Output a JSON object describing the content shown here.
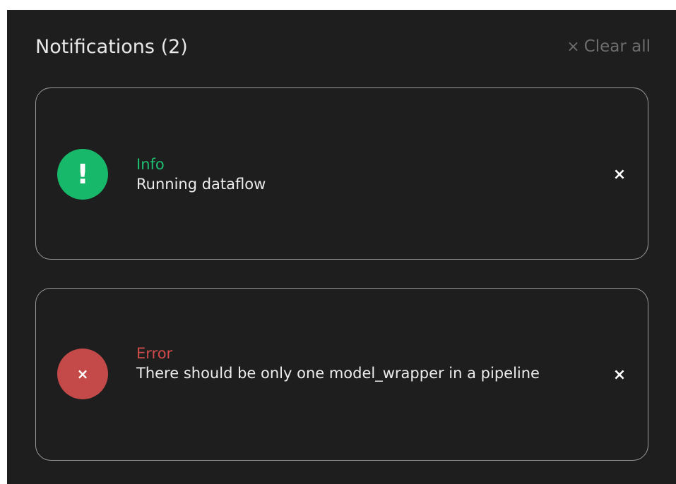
{
  "header": {
    "title": "Notifications (2)",
    "clear_icon": "×",
    "clear_label": "Clear all"
  },
  "notifications": [
    {
      "kind": "Info",
      "message": "Running dataflow",
      "icon": "!",
      "icon_name": "exclamation-icon",
      "color": "#18b86a",
      "dismiss": "×"
    },
    {
      "kind": "Error",
      "message": "There should be only one model_wrapper in a pipeline",
      "icon": "×",
      "icon_name": "error-x-icon",
      "color": "#c44a4a",
      "dismiss": "×"
    }
  ]
}
